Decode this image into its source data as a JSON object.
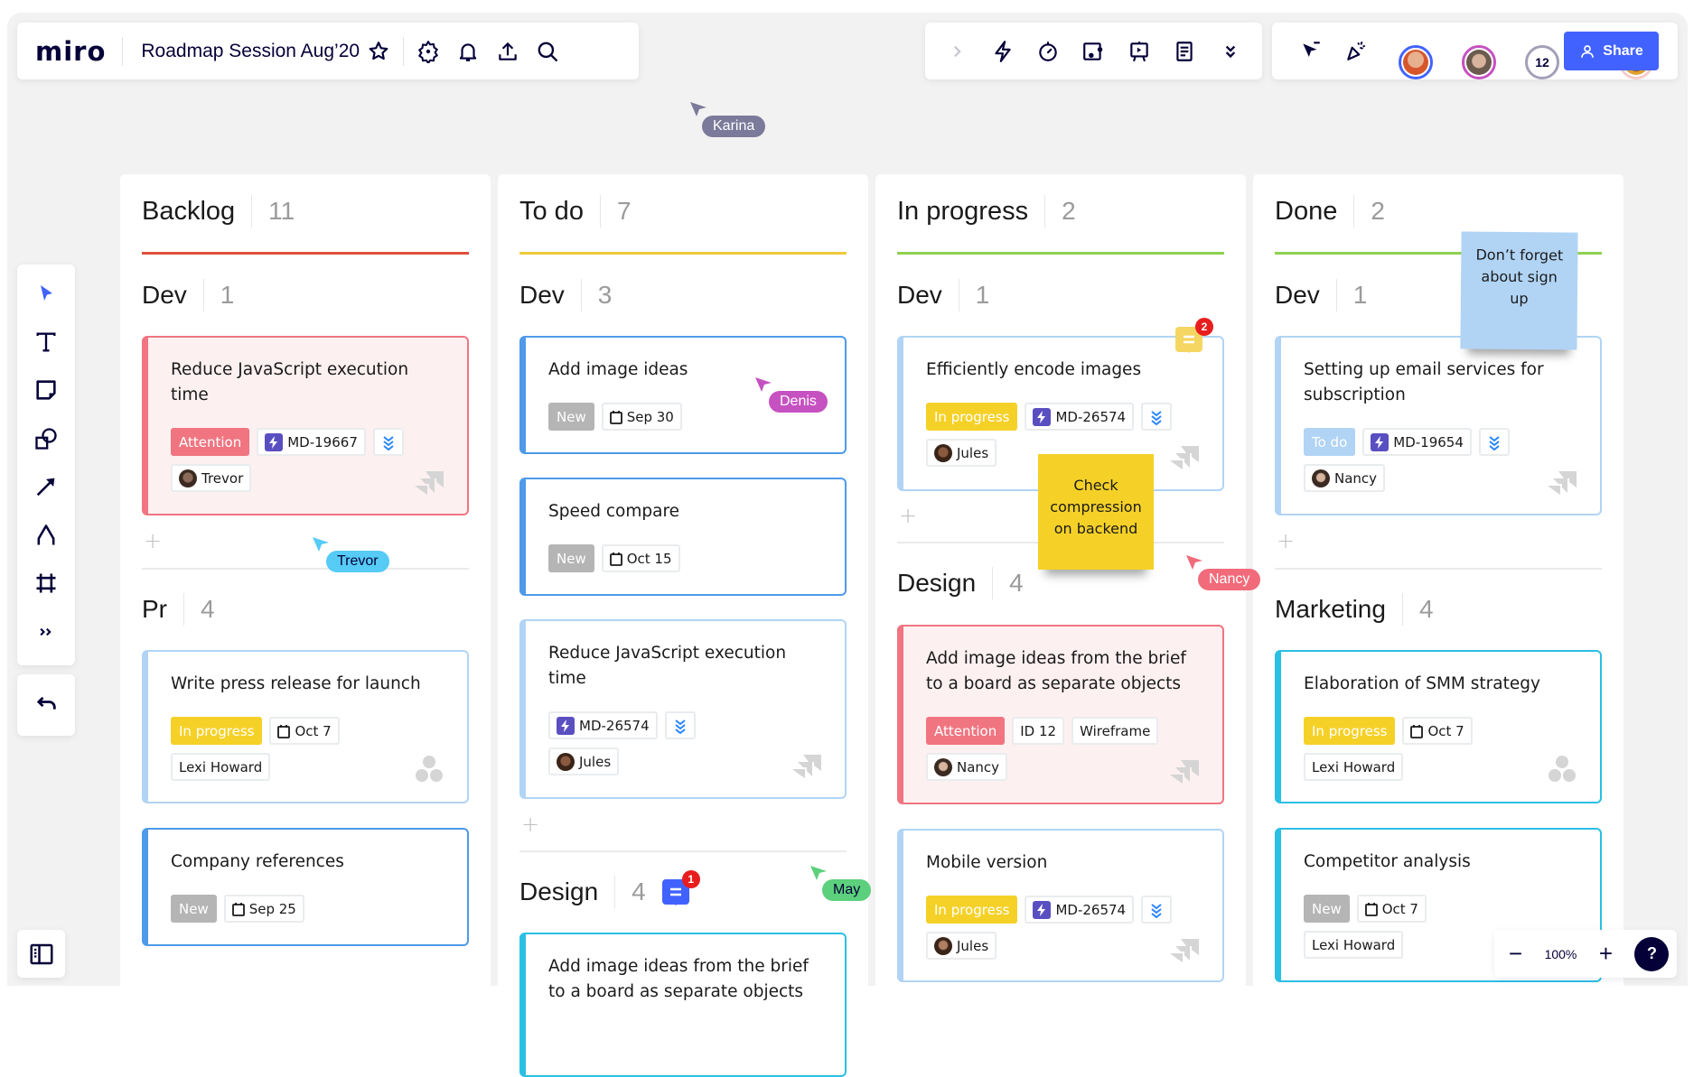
{
  "topbar": {
    "logo": "miro",
    "board_title": "Roadmap Session Aug’20",
    "icons": [
      "star-icon",
      "settings-icon",
      "bell-icon",
      "upload-icon",
      "search-icon"
    ],
    "tools": [
      "chevron-right-icon",
      "lightning-icon",
      "timer-icon",
      "card-icon",
      "presentation-icon",
      "notes-icon",
      "chevrons-down-icon"
    ],
    "collab_count": "12",
    "share_label": "Share"
  },
  "left_toolbar": [
    "select-icon",
    "text-icon",
    "sticky-note-icon",
    "shapes-icon",
    "arrow-icon",
    "pen-icon",
    "frame-icon",
    "more-tools-icon"
  ],
  "zoom": {
    "value": "100%",
    "help": "?"
  },
  "colors": {
    "accent": "#4262ff",
    "backlog_line": "#e04f3b",
    "todo_line": "#f0c93a",
    "progress_line": "#8fd14f",
    "attention": "#f07581",
    "in_progress": "#f5d128",
    "new": "#b5b5b5",
    "todo_status": "#b1d4f5"
  },
  "columns": [
    {
      "title": "Backlog",
      "count": "11",
      "groups": [
        {
          "title": "Dev",
          "count": "1",
          "cards": [
            {
              "title": "Reduce JavaScript execution time",
              "status": "Attention",
              "jira": "MD-19667",
              "assignee": "Trevor"
            }
          ]
        },
        {
          "title": "Pr",
          "count": "4",
          "cards": [
            {
              "title": "Write press release for launch",
              "status": "In progress",
              "date": "Oct 7",
              "assignee": "Lexi Howard"
            },
            {
              "title": "Company references",
              "status": "New",
              "date": "Sep 25"
            }
          ]
        }
      ]
    },
    {
      "title": "To do",
      "count": "7",
      "groups": [
        {
          "title": "Dev",
          "count": "3",
          "cards": [
            {
              "title": "Add image ideas",
              "status": "New",
              "date": "Sep 30"
            },
            {
              "title": "Speed compare",
              "status": "New",
              "date": "Oct 15"
            },
            {
              "title": "Reduce JavaScript execution time",
              "jira": "MD-26574",
              "assignee": "Jules"
            }
          ]
        },
        {
          "title": "Design",
          "count": "4",
          "comment_badge": "1",
          "cards": [
            {
              "title": "Add image ideas from the brief to a board as separate objects"
            }
          ]
        }
      ]
    },
    {
      "title": "In progress",
      "count": "2",
      "groups": [
        {
          "title": "Dev",
          "count": "1",
          "cards": [
            {
              "title": "Efficiently encode images",
              "status": "In progress",
              "jira": "MD-26574",
              "assignee": "Jules",
              "comment_badge": "2"
            }
          ]
        },
        {
          "title": "Design",
          "count": "4",
          "cards": [
            {
              "title": "Add image ideas from the brief to a board as separate objects",
              "status": "Attention",
              "id": "ID 12",
              "label": "Wireframe",
              "assignee": "Nancy"
            },
            {
              "title": "Mobile version",
              "status": "In progress",
              "jira": "MD-26574",
              "assignee": "Jules"
            }
          ]
        }
      ]
    },
    {
      "title": "Done",
      "count": "2",
      "groups": [
        {
          "title": "Dev",
          "count": "1",
          "cards": [
            {
              "title": "Setting up email services for subscription",
              "status": "To do",
              "jira": "MD-19654",
              "assignee": "Nancy"
            }
          ]
        },
        {
          "title": "Marketing",
          "count": "4",
          "cards": [
            {
              "title": "Elaboration of SMM strategy",
              "status": "In progress",
              "date": "Oct 7",
              "assignee": "Lexi Howard"
            },
            {
              "title": "Competitor analysis",
              "status": "New",
              "date": "Oct 7",
              "assignee": "Lexi Howard"
            }
          ]
        }
      ]
    }
  ],
  "stickies": [
    {
      "text": "Don’t forget about sign up",
      "color": "#b1d4f5"
    },
    {
      "text": "Check compression on backend",
      "color": "#f5d128"
    }
  ],
  "cursors": [
    {
      "name": "Karina",
      "color": "#7b7a9b"
    },
    {
      "name": "Denis",
      "color": "#c651c1"
    },
    {
      "name": "Trevor",
      "color": "#55cbf5"
    },
    {
      "name": "Nancy",
      "color": "#f26b7a"
    },
    {
      "name": "May",
      "color": "#5cd07c"
    }
  ]
}
